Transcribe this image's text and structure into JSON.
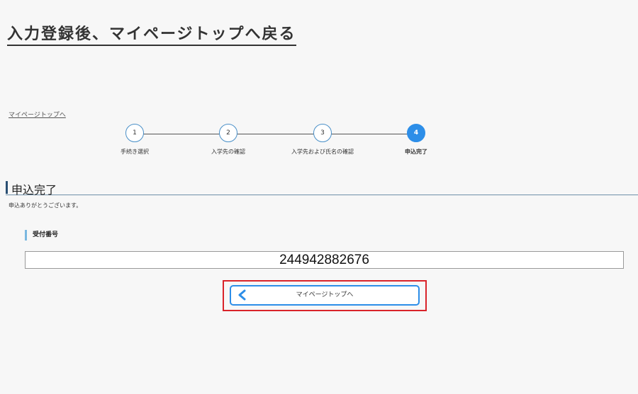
{
  "header": {
    "title": "入力登録後、マイページトップへ戻る"
  },
  "nav": {
    "top_link": "マイページトップへ"
  },
  "stepper": {
    "current": 4,
    "steps": [
      {
        "number": "1",
        "label": "手続き選択"
      },
      {
        "number": "2",
        "label": "入学先の確認"
      },
      {
        "number": "3",
        "label": "入学先および氏名の確認"
      },
      {
        "number": "4",
        "label": "申込完了"
      }
    ]
  },
  "main": {
    "heading": "申込完了",
    "message": "申込ありがとうございます。",
    "receipt_label": "受付番号",
    "receipt_number": "244942882676",
    "back_button_label": "マイページトップへ"
  },
  "colors": {
    "accent": "#2d8ee8",
    "highlight": "#d9232a",
    "heading_bar": "#2a4f73"
  },
  "icons": {
    "back_button": "chevron-left-icon"
  }
}
